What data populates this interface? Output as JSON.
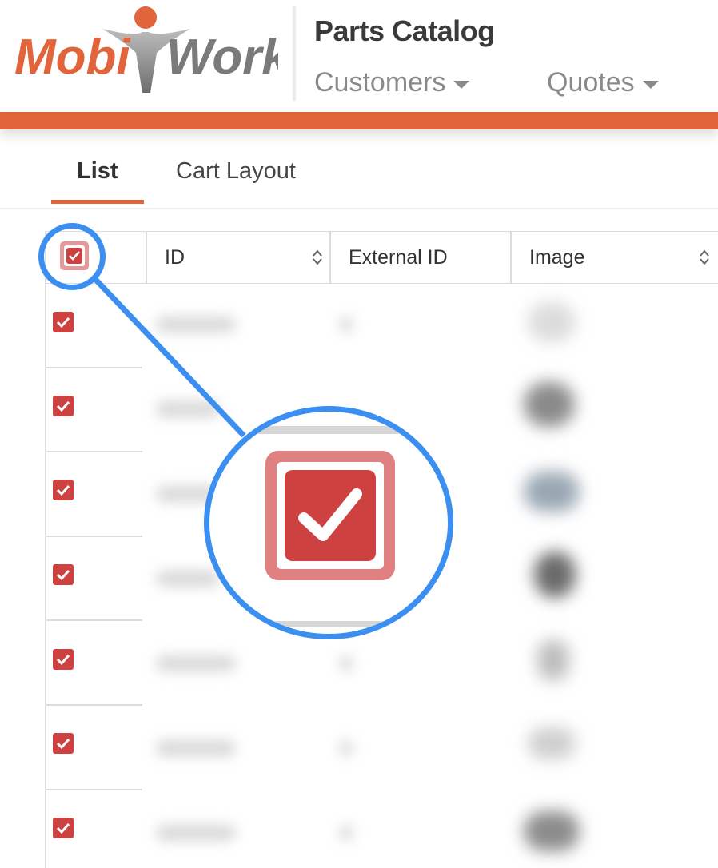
{
  "header": {
    "logo_text_left": "Mobi",
    "logo_text_right": "Work",
    "app_title": "Parts Catalog",
    "nav": [
      {
        "label": "Customers"
      },
      {
        "label": "Quotes"
      }
    ]
  },
  "tabs": [
    {
      "label": "List",
      "active": true
    },
    {
      "label": "Cart Layout",
      "active": false
    }
  ],
  "table": {
    "columns": [
      {
        "label": "ID",
        "sortable": true
      },
      {
        "label": "External ID",
        "sortable": false
      },
      {
        "label": "Image",
        "sortable": true
      }
    ],
    "select_all_checked": true,
    "rows_checked": [
      true,
      true,
      true,
      true,
      true,
      true,
      true
    ]
  },
  "colors": {
    "brand_orange": "#e2643a",
    "checkbox_red": "#cd4141",
    "callout_blue": "#3b8ff0"
  }
}
